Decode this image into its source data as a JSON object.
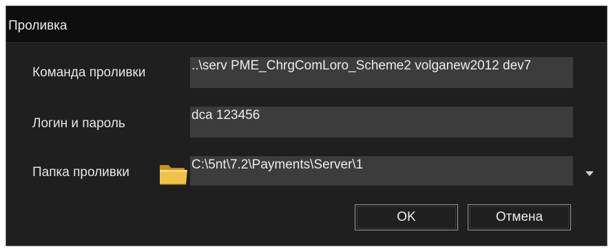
{
  "window": {
    "title": "Проливка"
  },
  "form": {
    "command_label": "Команда проливки",
    "command_value": "..\\serv PME_ChrgComLoro_Scheme2 volganew2012 dev7",
    "login_label": "Логин и пароль",
    "login_value": "dca 123456",
    "folder_label": "Папка проливки",
    "folder_value": "C:\\5nt\\7.2\\Payments\\Server\\1"
  },
  "buttons": {
    "ok_label": "OK",
    "cancel_label": "Отмена"
  },
  "icons": {
    "folder": "folder-icon",
    "dropdown": "chevron-down-icon"
  },
  "colors": {
    "background": "#1f1f1f",
    "field": "#3c3c3c",
    "folder": "#e8b63c"
  }
}
